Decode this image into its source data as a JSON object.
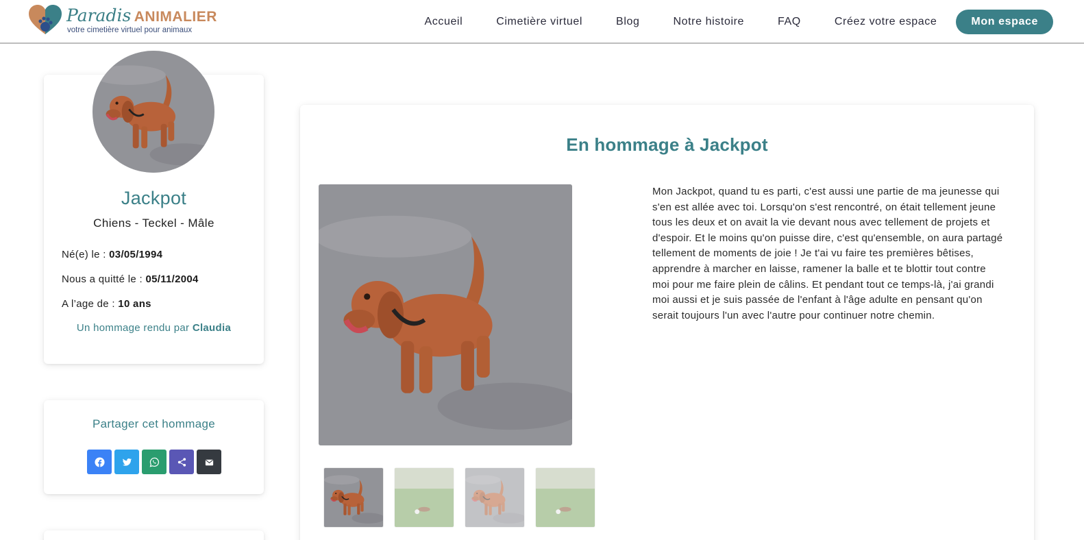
{
  "brand": {
    "script": "Paradis",
    "caps": "ANIMALIER",
    "tagline": "votre cimetière virtuel pour animaux"
  },
  "nav": {
    "items": [
      "Accueil",
      "Cimetière virtuel",
      "Blog",
      "Notre histoire",
      "FAQ",
      "Créez votre espace"
    ],
    "cta": "Mon espace"
  },
  "profile": {
    "name": "Jackpot",
    "species": "Chiens - Teckel - Mâle",
    "born_label": "Né(e) le :",
    "born_value": "03/05/1994",
    "died_label": "Nous a quitté le :",
    "died_value": "05/11/2004",
    "age_label": "A l’age de :",
    "age_value": "10 ans",
    "tribute_by_label": "Un hommage rendu par",
    "tribute_by_value": "Claudia"
  },
  "share": {
    "title": "Partager cet hommage",
    "buttons": [
      {
        "icon": "facebook-icon",
        "color": "#3b82f6"
      },
      {
        "icon": "twitter-icon",
        "color": "#2ea3ec"
      },
      {
        "icon": "whatsapp-icon",
        "color": "#2a9d6f"
      },
      {
        "icon": "share-icon",
        "color": "#5a57b5"
      },
      {
        "icon": "mail-icon",
        "color": "#353a40"
      }
    ]
  },
  "tribute": {
    "title": "En hommage à Jackpot",
    "lines": [
      "Mon Jackpot, quand tu es parti, c'est aussi une partie de ma jeunesse qui",
      "s'en est allée avec toi. Lorsqu'on s'est rencontré, on était tellement jeune",
      "tous les deux et on avait la vie devant nous avec tellement de projets et",
      "d'espoir. Et le moins qu'on puisse dire, c'est qu'ensemble, on aura partagé",
      "tellement de moments de joie ! Je t'ai vu faire tes premières bêtises,",
      "apprendre à marcher en laisse, ramener la balle et te blottir tout contre",
      "moi pour me faire plein de câlins. Et pendant tout ce temps-là, j'ai grandi",
      "moi aussi et je suis passée de l'enfant à l'âge adulte en pensant qu'on",
      "serait toujours l'un avec l'autre pour continuer notre chemin."
    ]
  },
  "colors": {
    "accent": "#3b8088",
    "brand_orange": "#c8895c"
  }
}
